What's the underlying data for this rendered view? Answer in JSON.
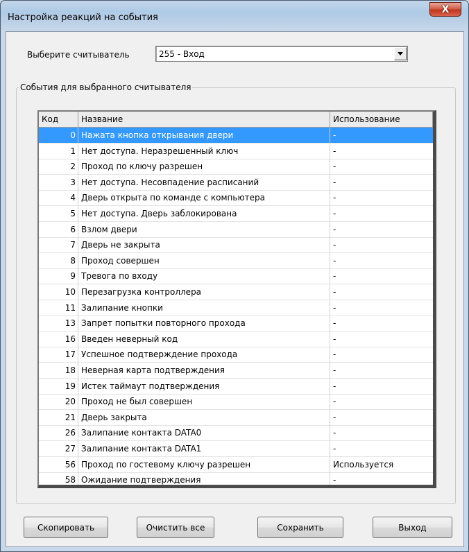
{
  "window": {
    "title": "Настройка реакций на события",
    "close_glyph": "X"
  },
  "reader": {
    "label": "Выберите считыватель",
    "selected": "255 - Вход"
  },
  "events_group": {
    "title": "События для выбранного считывателя"
  },
  "table": {
    "headers": {
      "code": "Код",
      "name": "Название",
      "usage": "Использование"
    },
    "selected_index": 0,
    "rows": [
      {
        "code": "0",
        "name": "Нажата кнопка открывания двери",
        "usage": "-"
      },
      {
        "code": "1",
        "name": "Нет доступа. Неразрешенный ключ",
        "usage": "-"
      },
      {
        "code": "2",
        "name": "Проход по ключу разрешен",
        "usage": "-"
      },
      {
        "code": "3",
        "name": "Нет доступа. Несовпадение расписаний",
        "usage": "-"
      },
      {
        "code": "4",
        "name": "Дверь открыта по команде с компьютера",
        "usage": "-"
      },
      {
        "code": "5",
        "name": "Нет доступа. Дверь заблокирована",
        "usage": "-"
      },
      {
        "code": "6",
        "name": "Взлом двери",
        "usage": "-"
      },
      {
        "code": "7",
        "name": "Дверь не закрыта",
        "usage": "-"
      },
      {
        "code": "8",
        "name": "Проход совершен",
        "usage": "-"
      },
      {
        "code": "9",
        "name": "Тревога по входу",
        "usage": "-"
      },
      {
        "code": "10",
        "name": "Перезагрузка контроллера",
        "usage": "-"
      },
      {
        "code": "11",
        "name": "Залипание кнопки",
        "usage": "-"
      },
      {
        "code": "13",
        "name": "Запрет попытки повторного прохода",
        "usage": "-"
      },
      {
        "code": "16",
        "name": "Введен неверный код",
        "usage": "-"
      },
      {
        "code": "17",
        "name": "Успешное подтверждение прохода",
        "usage": "-"
      },
      {
        "code": "18",
        "name": "Неверная карта подтверждения",
        "usage": "-"
      },
      {
        "code": "19",
        "name": "Истек таймаут подтверждения",
        "usage": "-"
      },
      {
        "code": "20",
        "name": "Проход не был совершен",
        "usage": "-"
      },
      {
        "code": "21",
        "name": "Дверь закрыта",
        "usage": "-"
      },
      {
        "code": "26",
        "name": "Залипание контакта DATA0",
        "usage": "-"
      },
      {
        "code": "27",
        "name": "Залипание контакта DATA1",
        "usage": "-"
      },
      {
        "code": "56",
        "name": "Проход по гостевому ключу разрешен",
        "usage": "Используется"
      },
      {
        "code": "58",
        "name": "Ожидание подтверждения",
        "usage": "-"
      }
    ]
  },
  "buttons": {
    "copy": "Скопировать",
    "clear_all": "Очистить все",
    "save": "Сохранить",
    "exit": "Выход"
  },
  "colors": {
    "selection": "#3399ff",
    "close_button": "#c2341c"
  }
}
